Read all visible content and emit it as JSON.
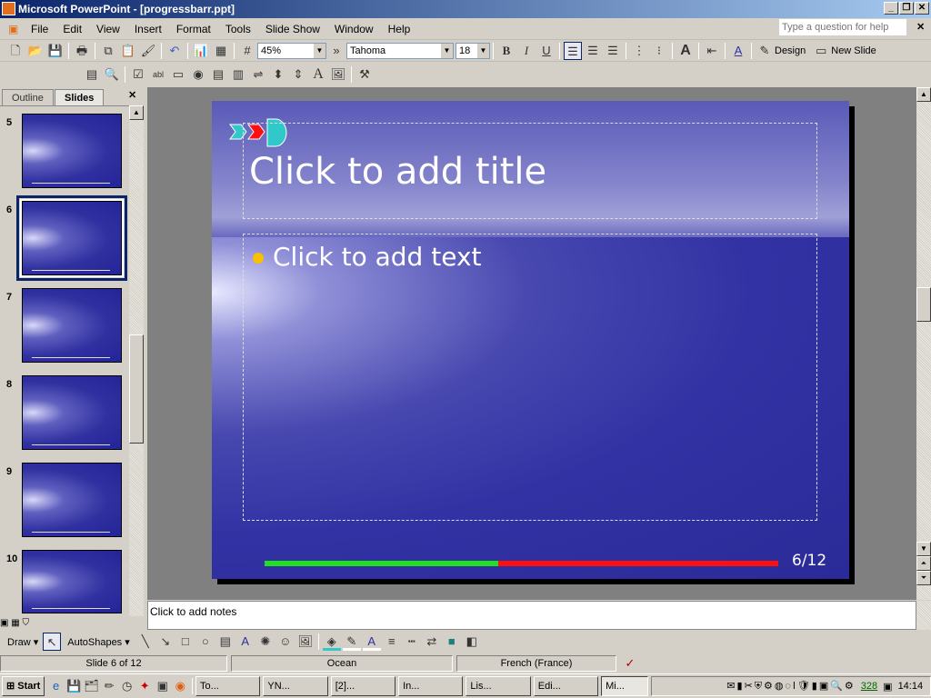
{
  "window": {
    "title": "Microsoft PowerPoint - [progressbarr.ppt]",
    "minimize": "_",
    "restore": "❐",
    "close": "✕"
  },
  "menu": [
    "File",
    "Edit",
    "View",
    "Insert",
    "Format",
    "Tools",
    "Slide Show",
    "Window",
    "Help"
  ],
  "help": {
    "placeholder": "Type a question for help",
    "close": "✕"
  },
  "toolbar": {
    "zoom": "45%",
    "font": "Tahoma",
    "size": "18",
    "bold": "B",
    "italic": "I",
    "underline": "U",
    "design": "Design",
    "new_slide": "New Slide",
    "more": "»"
  },
  "panes": {
    "tab_outline": "Outline",
    "tab_slides": "Slides",
    "close": "✕"
  },
  "thumbnails": [
    {
      "num": "5"
    },
    {
      "num": "6",
      "selected": true
    },
    {
      "num": "7"
    },
    {
      "num": "8"
    },
    {
      "num": "9"
    },
    {
      "num": "10"
    }
  ],
  "slide": {
    "title": "Click to add title",
    "body": "Click to add text",
    "progress_label": "6/12",
    "progress_fraction": 0.455,
    "colors": {
      "done": "#20e020",
      "remaining": "#ff1010",
      "bullet": "#f8c000"
    }
  },
  "notes": "Click to add notes",
  "drawing": {
    "draw": "Draw ▾",
    "autoshapes": "AutoShapes ▾"
  },
  "status": {
    "slide": "Slide 6 of 12",
    "design": "Ocean",
    "language": "French (France)"
  },
  "taskbar": {
    "start": "Start",
    "tasks": [
      "To...",
      "YN...",
      "[2]...",
      "In...",
      "Lis...",
      "Edi...",
      "Mi..."
    ],
    "tray_count": "328",
    "clock": "14:14"
  }
}
